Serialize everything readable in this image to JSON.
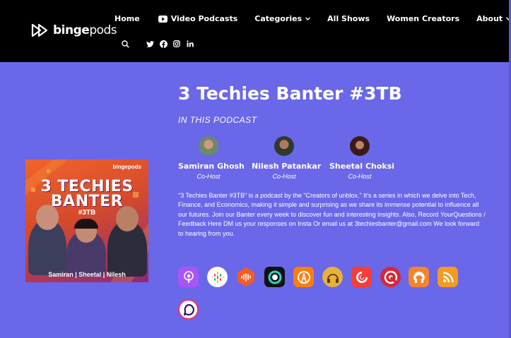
{
  "brand": {
    "logo_bold": "binge",
    "logo_light": "pods"
  },
  "nav": {
    "items": [
      {
        "label": "Home"
      },
      {
        "label": "Video Podcasts"
      },
      {
        "label": "Categories"
      },
      {
        "label": "All Shows"
      },
      {
        "label": "Women Creators"
      },
      {
        "label": "About"
      }
    ]
  },
  "social": [
    "search-icon",
    "twitter-icon",
    "facebook-icon",
    "instagram-icon",
    "linkedin-icon"
  ],
  "podcast": {
    "title": "3 Techies Banter #3TB",
    "section_label": "IN THIS PODCAST",
    "cover": {
      "brand": "bingepods",
      "title_line1": "3 TECHIES",
      "title_line2": "BANTER",
      "tag": "#3TB",
      "names": "Samiran | Sheetal | Nilesh"
    },
    "hosts": [
      {
        "name": "Samiran Ghosh",
        "role": "Co-Host"
      },
      {
        "name": "Nilesh Patankar",
        "role": "Co-Host"
      },
      {
        "name": "Sheetal Choksi",
        "role": "Co-Host"
      }
    ],
    "description": "\"3 Techies Banter #3TB\" is a podcast by the \"Creators of unblox.\" It's a series in which we delve into Tech, Finance, and Economics, making it simple and surprising as we share its immense potential to influence all our futures. Join our Banter every week to discover fun and interesting insights. Also, Record YourQuestions / Feedback Here DM us your responses on Insta Or email us at 3techiesbanter@gmail.com We look forward to hearing from you."
  },
  "platforms": [
    {
      "icon": "apple-podcasts-icon",
      "color": "#a855f7"
    },
    {
      "icon": "google-podcasts-icon",
      "color": "#ffffff"
    },
    {
      "icon": "castbox-icon",
      "color": "#f55b23"
    },
    {
      "icon": "pocket-casts-ring-icon",
      "color": "#111111"
    },
    {
      "icon": "overcast-icon",
      "color": "#fc7e0f"
    },
    {
      "icon": "podcast-addict-headphones-icon",
      "color": "#e8b13a"
    },
    {
      "icon": "pocket-casts-icon",
      "color": "#f43e37"
    },
    {
      "icon": "castro-icon",
      "color": "#d6283a"
    },
    {
      "icon": "podcast-addict-icon",
      "color": "#f4842d"
    },
    {
      "icon": "rss-feed-icon",
      "color": "#f59a23"
    },
    {
      "icon": "podchaser-icon",
      "color": "#e8356d"
    }
  ]
}
